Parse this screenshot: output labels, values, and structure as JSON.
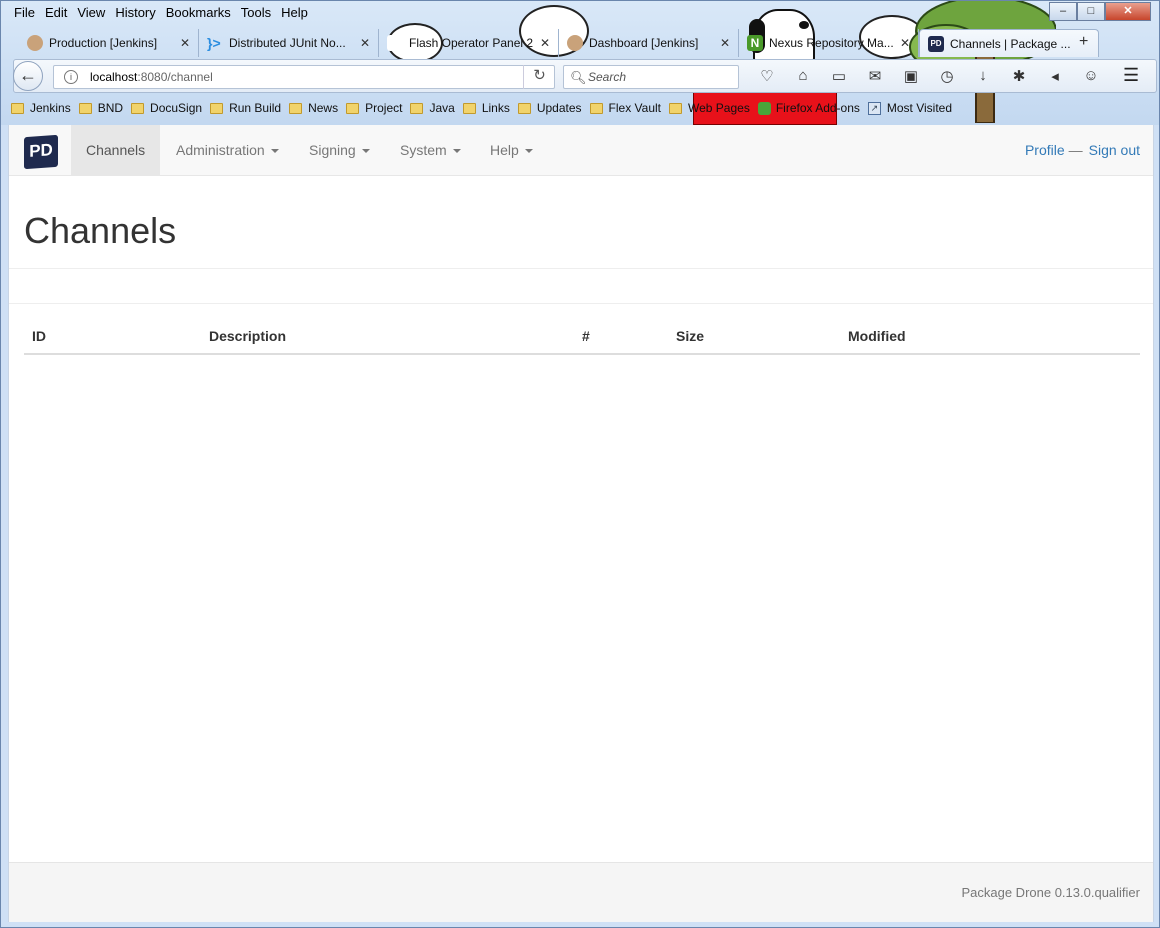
{
  "menu": [
    "File",
    "Edit",
    "View",
    "History",
    "Bookmarks",
    "Tools",
    "Help"
  ],
  "window_controls": {
    "minimize": "–",
    "maximize": "□",
    "close": "✕"
  },
  "tabs": [
    {
      "label": "Production [Jenkins]",
      "icon": "jenkins-icon",
      "color": "#c9a27a"
    },
    {
      "label": "Distributed JUnit No...",
      "icon": "chevron-logo-icon",
      "color": "#2a8de0"
    },
    {
      "label": "Flash Operator Panel 2",
      "icon": "page-icon",
      "color": "#ffffff"
    },
    {
      "label": "Dashboard [Jenkins]",
      "icon": "jenkins-icon",
      "color": "#c9a27a"
    },
    {
      "label": "Nexus Repository Ma...",
      "icon": "nexus-icon",
      "color": "#4a9a2a"
    },
    {
      "label": "Channels | Package ...",
      "icon": "package-drone-icon",
      "color": "#1f2a4e"
    }
  ],
  "new_tab": "+",
  "url": {
    "host": "localhost",
    "path": ":8080/channel"
  },
  "search_placeholder": "Search",
  "bookmarks": [
    {
      "label": "Jenkins",
      "type": "folder"
    },
    {
      "label": "BND",
      "type": "folder"
    },
    {
      "label": "DocuSign",
      "type": "folder"
    },
    {
      "label": "Run Build",
      "type": "folder"
    },
    {
      "label": "News",
      "type": "folder"
    },
    {
      "label": "Project",
      "type": "folder"
    },
    {
      "label": "Java",
      "type": "folder"
    },
    {
      "label": "Links",
      "type": "folder"
    },
    {
      "label": "Updates",
      "type": "folder"
    },
    {
      "label": "Flex Vault",
      "type": "folder"
    },
    {
      "label": "Web Pages",
      "type": "folder"
    },
    {
      "label": "Firefox Add-ons",
      "type": "addon"
    },
    {
      "label": "Most Visited",
      "type": "special"
    }
  ],
  "app": {
    "logo": "PD",
    "nav": [
      {
        "label": "Channels",
        "active": true,
        "dropdown": false
      },
      {
        "label": "Administration",
        "active": false,
        "dropdown": true
      },
      {
        "label": "Signing",
        "active": false,
        "dropdown": true
      },
      {
        "label": "System",
        "active": false,
        "dropdown": true
      },
      {
        "label": "Help",
        "active": false,
        "dropdown": true
      }
    ],
    "profile": "Profile",
    "separator": "—",
    "signout": "Sign out",
    "title": "Channels",
    "table_headers": [
      "ID",
      "Description",
      "#",
      "Size",
      "Modified"
    ],
    "table_rows": [],
    "footer": "Package Drone 0.13.0.qualifier"
  },
  "colors": {
    "link": "#337ab7",
    "doghouse": "#e8111a",
    "logo": "#1f2a4e"
  }
}
